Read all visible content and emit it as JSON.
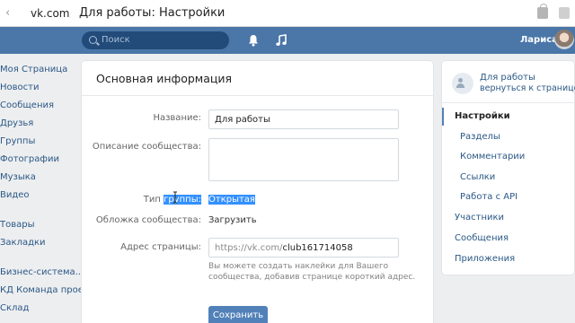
{
  "browser": {
    "host": "vk.com",
    "title": "Для работы: Настройки"
  },
  "header": {
    "search_placeholder": "Поиск",
    "user_name": "Лариса"
  },
  "left_nav": [
    "Моя Страница",
    "Новости",
    "Сообщения",
    "Друзья",
    "Группы",
    "Фотографии",
    "Музыка",
    "Видео",
    "Товары",
    "Закладки",
    "Бизнес-система...",
    "КД Команда проек...",
    "Склад"
  ],
  "main": {
    "title": "Основная информация",
    "name_label": "Название:",
    "name_value": "Для работы",
    "description_label": "Описание сообщества:",
    "description_value": "",
    "type_label_pre": "Тип ",
    "type_label_sel": "группы:",
    "type_value": "Открытая",
    "cover_label": "Обложка сообщества:",
    "cover_action": "Загрузить",
    "address_label": "Адрес страницы:",
    "address_prefix": "https://vk.com/",
    "address_value": "club161714058",
    "address_hint": "Вы можете создать наклейки для Вашего сообщества, добавив странице короткий адрес.",
    "save_label": "Сохранить"
  },
  "right_menu": {
    "group_name": "Для работы",
    "back_label": "вернуться к странице",
    "items": [
      {
        "label": "Настройки",
        "active": true,
        "sub": false
      },
      {
        "label": "Разделы",
        "active": false,
        "sub": true
      },
      {
        "label": "Комментарии",
        "active": false,
        "sub": true
      },
      {
        "label": "Ссылки",
        "active": false,
        "sub": true
      },
      {
        "label": "Работа с API",
        "active": false,
        "sub": true
      },
      {
        "label": "Участники",
        "active": false,
        "sub": false
      },
      {
        "label": "Сообщения",
        "active": false,
        "sub": false
      },
      {
        "label": "Приложения",
        "active": false,
        "sub": false
      }
    ]
  },
  "colors": {
    "header": "#4a76a8",
    "link": "#2a5885",
    "button": "#5181b8",
    "selection": "#3390ff"
  }
}
